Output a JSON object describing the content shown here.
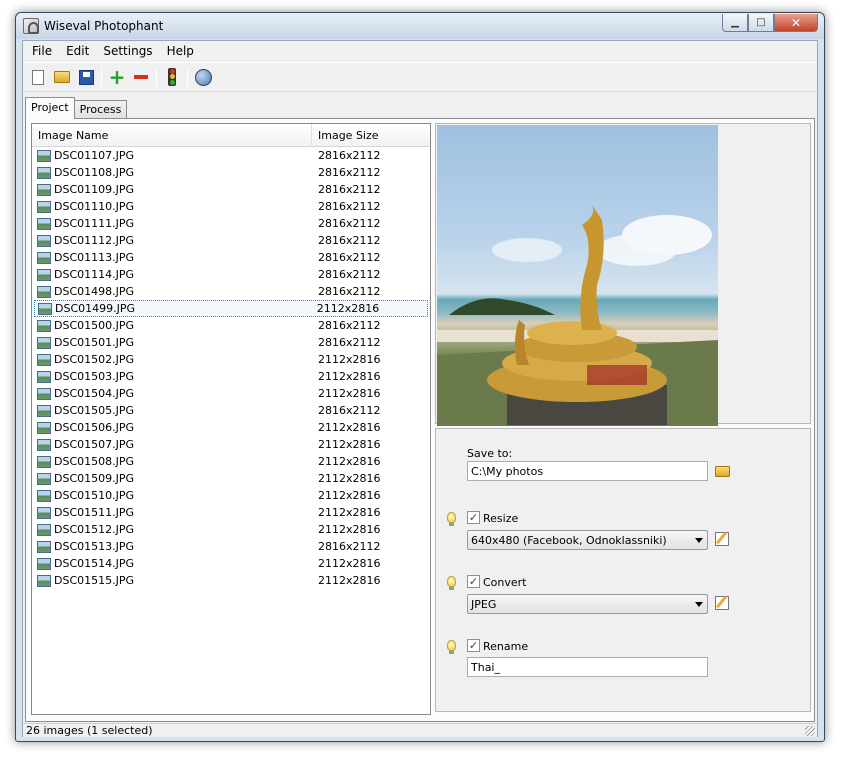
{
  "window": {
    "title": "Wiseval Photophant"
  },
  "menu": [
    "File",
    "Edit",
    "Settings",
    "Help"
  ],
  "toolbar": {
    "icons": [
      "new-document-icon",
      "open-folder-icon",
      "save-icon",
      "add-icon",
      "remove-icon",
      "traffic-light-icon",
      "globe-icon"
    ]
  },
  "tabs": [
    {
      "label": "Project",
      "active": true
    },
    {
      "label": "Process",
      "active": false
    }
  ],
  "list": {
    "columns": {
      "name": "Image Name",
      "size": "Image Size"
    },
    "rows": [
      {
        "name": "DSC01107.JPG",
        "size": "2816x2112"
      },
      {
        "name": "DSC01108.JPG",
        "size": "2816x2112"
      },
      {
        "name": "DSC01109.JPG",
        "size": "2816x2112"
      },
      {
        "name": "DSC01110.JPG",
        "size": "2816x2112"
      },
      {
        "name": "DSC01111.JPG",
        "size": "2816x2112"
      },
      {
        "name": "DSC01112.JPG",
        "size": "2816x2112"
      },
      {
        "name": "DSC01113.JPG",
        "size": "2816x2112"
      },
      {
        "name": "DSC01114.JPG",
        "size": "2816x2112"
      },
      {
        "name": "DSC01498.JPG",
        "size": "2816x2112"
      },
      {
        "name": "DSC01499.JPG",
        "size": "2112x2816",
        "selected": true
      },
      {
        "name": "DSC01500.JPG",
        "size": "2816x2112"
      },
      {
        "name": "DSC01501.JPG",
        "size": "2816x2112"
      },
      {
        "name": "DSC01502.JPG",
        "size": "2112x2816"
      },
      {
        "name": "DSC01503.JPG",
        "size": "2112x2816"
      },
      {
        "name": "DSC01504.JPG",
        "size": "2112x2816"
      },
      {
        "name": "DSC01505.JPG",
        "size": "2816x2112"
      },
      {
        "name": "DSC01506.JPG",
        "size": "2112x2816"
      },
      {
        "name": "DSC01507.JPG",
        "size": "2112x2816"
      },
      {
        "name": "DSC01508.JPG",
        "size": "2112x2816"
      },
      {
        "name": "DSC01509.JPG",
        "size": "2112x2816"
      },
      {
        "name": "DSC01510.JPG",
        "size": "2112x2816"
      },
      {
        "name": "DSC01511.JPG",
        "size": "2112x2816"
      },
      {
        "name": "DSC01512.JPG",
        "size": "2112x2816"
      },
      {
        "name": "DSC01513.JPG",
        "size": "2816x2112"
      },
      {
        "name": "DSC01514.JPG",
        "size": "2112x2816"
      },
      {
        "name": "DSC01515.JPG",
        "size": "2112x2816"
      }
    ]
  },
  "settings": {
    "save_to_label": "Save to:",
    "save_to_value": "C:\\My photos",
    "resize_label": "Resize",
    "resize_checked": true,
    "resize_value": "640x480 (Facebook, Odnoklassniki)",
    "convert_label": "Convert",
    "convert_checked": true,
    "convert_value": "JPEG",
    "rename_label": "Rename",
    "rename_checked": true,
    "rename_value": "Thai_"
  },
  "status": {
    "text": "26 images (1 selected)"
  },
  "colors": {
    "selection_border": "#3c7fb1",
    "titlebar": "#c7d6e6",
    "close_button": "#c0432a"
  }
}
